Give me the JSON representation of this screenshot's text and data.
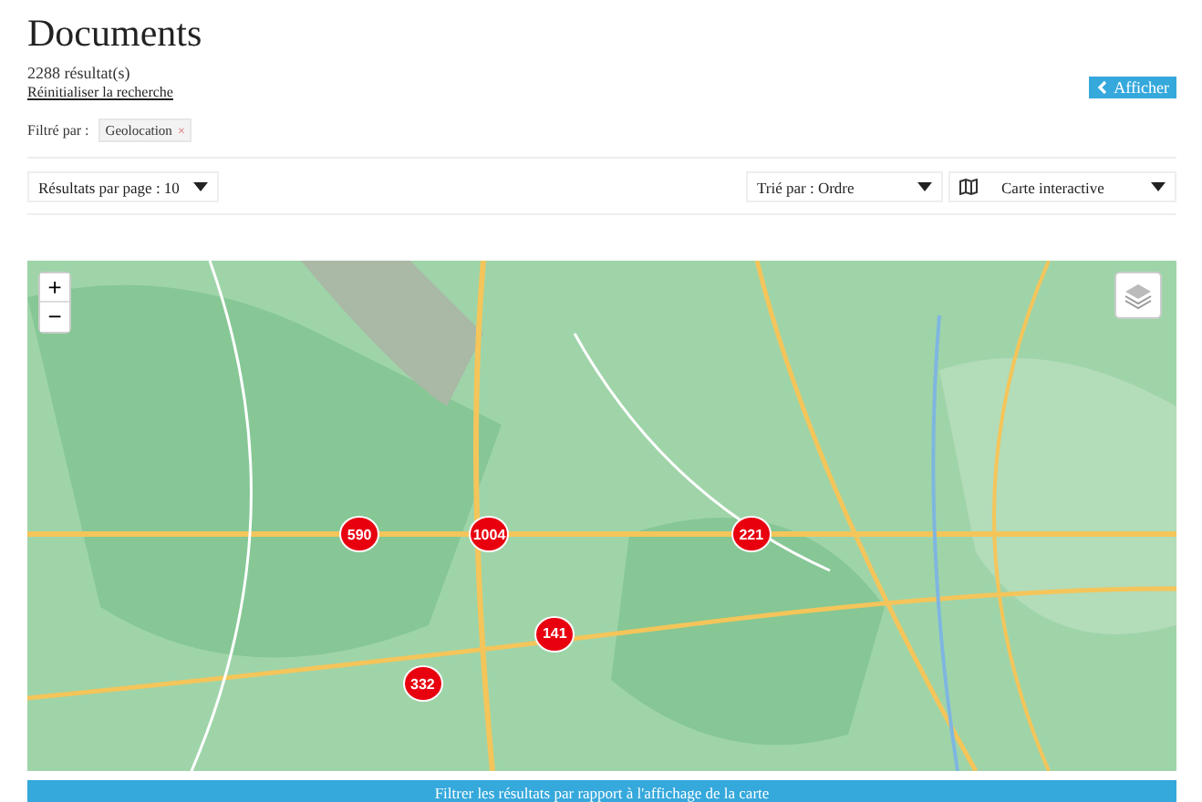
{
  "page": {
    "title": "Documents",
    "result_count": "2288 résultat(s)",
    "reset_link": "Réinitialiser la recherche",
    "show_button": "Afficher"
  },
  "filters": {
    "label": "Filtré par :",
    "tags": [
      {
        "label": "Geolocation",
        "remove": "×"
      }
    ]
  },
  "toolbar": {
    "per_page": "Résultats par page : 10",
    "sort": "Trié par : Ordre",
    "view": "Carte interactive"
  },
  "map": {
    "zoom_in": "+",
    "zoom_out": "−",
    "clusters": [
      {
        "count": "590"
      },
      {
        "count": "1004"
      },
      {
        "count": "221"
      },
      {
        "count": "141"
      },
      {
        "count": "332"
      }
    ]
  },
  "filter_button": "Filtrer les résultats par rapport à l'affichage de la carte"
}
